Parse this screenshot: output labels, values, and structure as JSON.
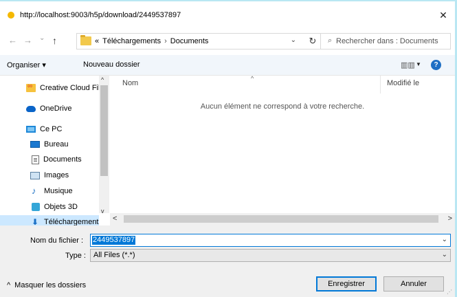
{
  "window": {
    "title": "http://localhost:9003/h5p/download/2449537897",
    "close_symbol": "✕"
  },
  "nav": {
    "back_symbol": "←",
    "forward_symbol": "→",
    "recent_symbol": "⌄",
    "up_symbol": "↑",
    "refresh_symbol": "↻"
  },
  "address": {
    "overflow": "«",
    "crumbs": [
      "Téléchargements",
      "Documents"
    ],
    "separator": "›",
    "dropdown_symbol": "⌄"
  },
  "search": {
    "placeholder": "Rechercher dans : Documents"
  },
  "toolbar": {
    "organize": "Organiser ▾",
    "new_folder": "Nouveau dossier",
    "view_symbol": "▥▥",
    "view_dropdown": "▼",
    "help": "?"
  },
  "sidebar": {
    "items": [
      {
        "label": "Creative Cloud Fil",
        "icon": "creative-cloud-icon"
      },
      {
        "label": "OneDrive",
        "icon": "onedrive-icon"
      },
      {
        "label": "Ce PC",
        "icon": "computer-icon"
      },
      {
        "label": "Bureau",
        "icon": "desktop-icon"
      },
      {
        "label": "Documents",
        "icon": "documents-icon"
      },
      {
        "label": "Images",
        "icon": "images-icon"
      },
      {
        "label": "Musique",
        "icon": "music-icon"
      },
      {
        "label": "Objets 3D",
        "icon": "3d-objects-icon"
      },
      {
        "label": "Téléchargements",
        "icon": "downloads-icon"
      }
    ],
    "selected_index": 8
  },
  "filelist": {
    "columns": [
      "Nom",
      "Modifié le"
    ],
    "sort_symbol": "^",
    "empty_message": "Aucun élément ne correspond à votre recherche."
  },
  "scroll": {
    "up": "^",
    "down": "v",
    "left": "<",
    "right": ">"
  },
  "form": {
    "filename_label": "Nom du fichier :",
    "filename_value": "2449537897",
    "type_label": "Type :",
    "type_value": "All Files (*.*)"
  },
  "footer": {
    "toggle_symbol": "^",
    "toggle_label": "Masquer les dossiers",
    "save_label": "Enregistrer",
    "cancel_label": "Annuler"
  },
  "colors": {
    "accent": "#0078d7",
    "selection": "#cce8ff",
    "title_dot": "#f5b800"
  }
}
